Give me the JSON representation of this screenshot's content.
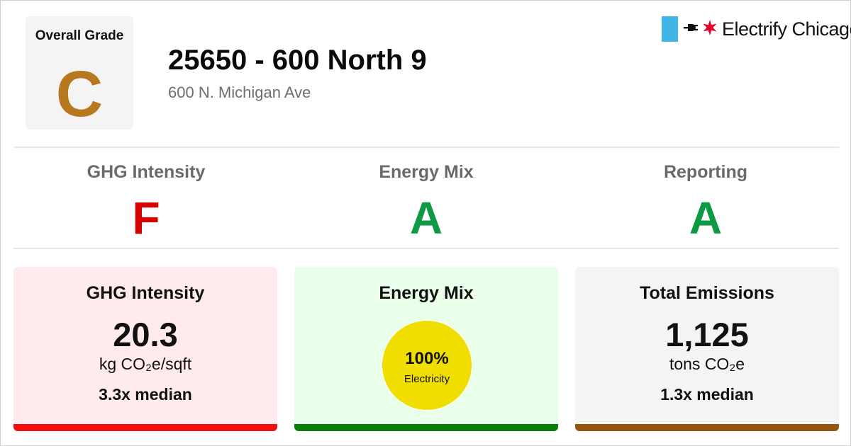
{
  "header": {
    "overall_grade_label": "Overall Grade",
    "overall_grade": "C",
    "overall_grade_color": "#b87820",
    "title": "25650 - 600 North 9",
    "address": "600 N. Michigan Ave"
  },
  "logo": {
    "text": "Electrify Chicago",
    "flag_color": "#41b6e6",
    "star_color": "#e4002b",
    "plug_icon": "plug-icon",
    "star_icon": "six-pointed-star-icon"
  },
  "subgrades": [
    {
      "label": "GHG Intensity",
      "grade": "F",
      "color": "#d90000"
    },
    {
      "label": "Energy Mix",
      "grade": "A",
      "color": "#0d9a43"
    },
    {
      "label": "Reporting",
      "grade": "A",
      "color": "#0d9a43"
    }
  ],
  "cards": {
    "ghg": {
      "title": "GHG Intensity",
      "value": "20.3",
      "unit": "kg CO₂e/sqft",
      "median": "3.3x median",
      "bg": "#ffebed",
      "bar": "#f20f0f"
    },
    "mix": {
      "title": "Energy Mix",
      "percent": "100%",
      "fuel": "Electricity",
      "fraction": 1.0,
      "bg": "#e9ffe9",
      "bar": "#0a7d0a",
      "pie_color": "#f0de00"
    },
    "emissions": {
      "title": "Total Emissions",
      "value": "1,125",
      "unit": "tons CO₂e",
      "median": "1.3x median",
      "bg": "#f4f4f4",
      "bar": "#94570f"
    }
  }
}
